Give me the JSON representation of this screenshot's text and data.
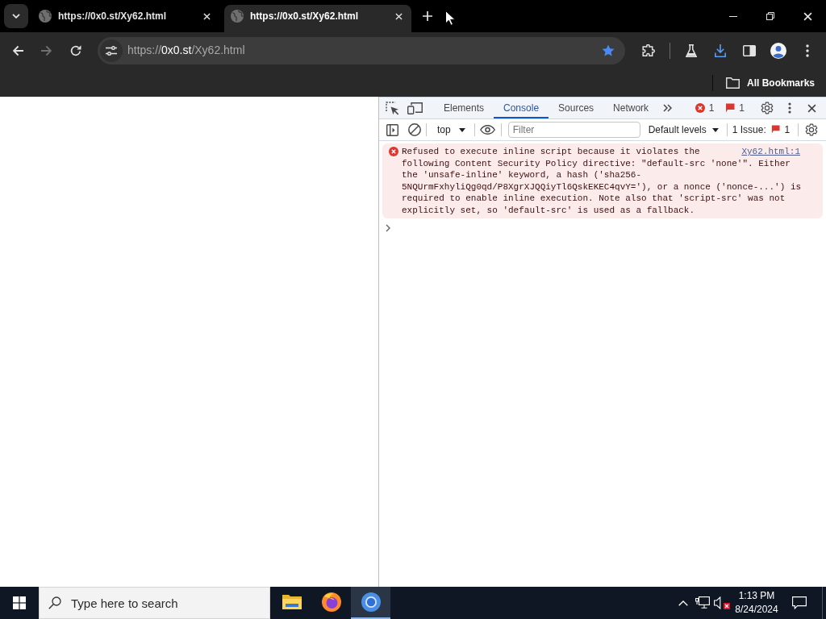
{
  "browser_tabs": [
    {
      "title": "https://0x0.st/Xy62.html",
      "selected": false
    },
    {
      "title": "https://0x0.st/Xy62.html",
      "selected": true
    }
  ],
  "toolbar": {
    "nav_buttons": [
      {
        "kind": "back",
        "disabled": false
      },
      {
        "kind": "forward",
        "disabled": true
      },
      {
        "kind": "reload",
        "disabled": false
      }
    ],
    "url": {
      "scheme": "https://",
      "host": "0x0.st",
      "path": "/Xy62.html"
    },
    "bookmarked": true
  },
  "bookmarks_bar": {
    "items": [
      {
        "label": "All Bookmarks"
      }
    ]
  },
  "devtools": {
    "tabs": [
      {
        "label": "Elements",
        "selected": false
      },
      {
        "label": "Console",
        "selected": true
      },
      {
        "label": "Sources",
        "selected": false
      },
      {
        "label": "Network",
        "selected": false
      }
    ],
    "error_count": "1",
    "issue_count": "1",
    "console_toolbar": {
      "context": "top",
      "filter": {
        "placeholder": "Filter"
      },
      "levels": "Default levels",
      "issues_label": "1 Issue:",
      "issues_count": "1"
    },
    "messages": [
      {
        "kind": "error",
        "text": "Refused to execute inline script because it violates the following Content Security Policy directive: \"default-src 'none'\". Either the 'unsafe-inline' keyword, a hash ('sha256-5NQUrmFxhyliQg0qd/P8XgrXJQQiyTl6QskEKEC4qvY='), or a nonce ('nonce-...') is required to enable inline execution. Note also that 'script-src' was not explicitly set, so 'default-src' is used as a fallback.",
        "source": "Xy62.html:1"
      }
    ]
  },
  "taskbar": {
    "search": {
      "placeholder": "Type here to search"
    },
    "apps": [
      {
        "kind": "explorer",
        "selected": false
      },
      {
        "kind": "firefox",
        "selected": false
      },
      {
        "kind": "chrome",
        "selected": true
      }
    ],
    "tray": {
      "volume_muted": true
    },
    "clock": {
      "time": "1:13 PM",
      "date": "8/24/2024"
    }
  }
}
